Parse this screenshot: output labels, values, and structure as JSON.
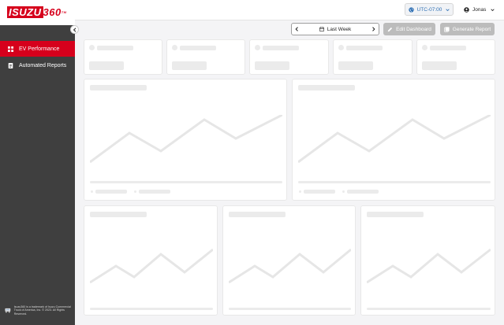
{
  "logo": {
    "brand": "ISUZU",
    "number": "360",
    "tm": "TM"
  },
  "sidebar": {
    "items": [
      {
        "label": "EV Performance",
        "icon": "dashboard-icon",
        "active": true
      },
      {
        "label": "Automated Reports",
        "icon": "report-icon",
        "active": false
      }
    ],
    "footer_text": "Isuzu360 is a trademark of Isuzu Commercial Truck of America, Inc. © 2023. All Rights Reserved."
  },
  "header": {
    "timezone": "UTC-07:00",
    "user": "Jonas"
  },
  "toolbar": {
    "date_range": "Last Week",
    "edit_label": "Edit Dashboard",
    "generate_label": "Generate Report"
  },
  "colors": {
    "brand_red": "#d6001c",
    "sidebar_bg": "#3f3f3f",
    "link_blue": "#2e6fb3",
    "disabled_button": "#bcbcbc",
    "skeleton": "#ebebeb"
  },
  "loading_state": true
}
